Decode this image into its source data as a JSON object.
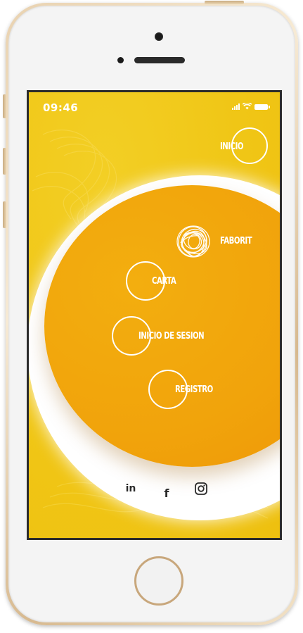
{
  "status_bar": {
    "time": "09:46",
    "signal_icon": "signal-bars-icon",
    "wifi_icon": "wifi-icon",
    "battery_icon": "battery-icon"
  },
  "menu": {
    "inicio": "INICIO",
    "faborit": "FABORIT",
    "carta": "CARTA",
    "inicio_sesion": "INICIO DE SESION",
    "registro": "REGISTRO"
  },
  "social": {
    "linkedin_label": "in",
    "facebook_label": "f",
    "instagram_icon": "instagram-icon"
  },
  "colors": {
    "background_yellow": "#f0c616",
    "disc_orange": "#f1a30b",
    "crescent_white": "#ffffff",
    "text_white": "#ffffff",
    "social_dark": "#2b2b2b"
  }
}
